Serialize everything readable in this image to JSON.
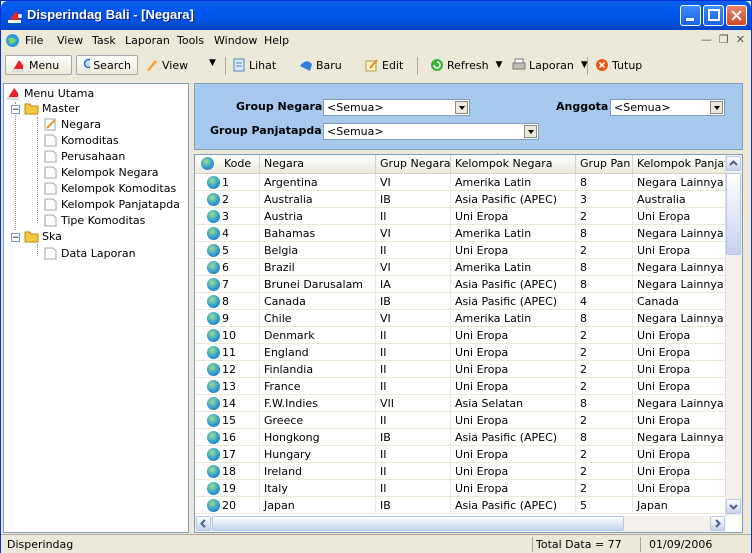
{
  "window": {
    "title": "Disperindag Bali - [Negara]"
  },
  "menu": [
    "File",
    "View",
    "Task",
    "Laporan",
    "Tools",
    "Window",
    "Help"
  ],
  "toolbar": {
    "menu": "Menu",
    "search": "Search",
    "view": "View",
    "lihat": "Lihat",
    "baru": "Baru",
    "edit": "Edit",
    "refresh": "Refresh",
    "laporan": "Laporan",
    "tutup": "Tutup"
  },
  "tree": {
    "root": "Menu Utama",
    "master": "Master",
    "master_items": [
      "Negara",
      "Komoditas",
      "Perusahaan",
      "Kelompok Negara",
      "Kelompok Komoditas",
      "Kelompok Panjatapda",
      "Tipe Komoditas"
    ],
    "ska": "Ska",
    "ska_items": [
      "Data Laporan"
    ]
  },
  "filters": {
    "group_negara_label": "Group Negara",
    "group_negara_value": "<Semua>",
    "anggota_label": "Anggota",
    "anggota_value": "<Semua>",
    "group_panjatapda_label": "Group Panjatapda",
    "group_panjatapda_value": "<Semua>"
  },
  "grid": {
    "columns": [
      "Kode",
      "Negara",
      "Grup Negara",
      "Kelompok Negara",
      "Grup Pan",
      "Kelompok Panjata"
    ],
    "rows": [
      [
        "1",
        "Argentina",
        "VI",
        "Amerika Latin",
        "8",
        "Negara Lainnya"
      ],
      [
        "2",
        "Australia",
        "IB",
        "Asia Pasific (APEC)",
        "3",
        "Australia"
      ],
      [
        "3",
        "Austria",
        "II",
        "Uni Eropa",
        "2",
        "Uni Eropa"
      ],
      [
        "4",
        "Bahamas",
        "VI",
        "Amerika Latin",
        "8",
        "Negara Lainnya"
      ],
      [
        "5",
        "Belgia",
        "II",
        "Uni Eropa",
        "2",
        "Uni Eropa"
      ],
      [
        "6",
        "Brazil",
        "VI",
        "Amerika Latin",
        "8",
        "Negara Lainnya"
      ],
      [
        "7",
        "Brunei Darusalam",
        "IA",
        "Asia Pasific (APEC)",
        "8",
        "Negara Lainnya"
      ],
      [
        "8",
        "Canada",
        "IB",
        "Asia Pasific (APEC)",
        "4",
        "Canada"
      ],
      [
        "9",
        "Chile",
        "VI",
        "Amerika Latin",
        "8",
        "Negara Lainnya"
      ],
      [
        "10",
        "Denmark",
        "II",
        "Uni Eropa",
        "2",
        "Uni Eropa"
      ],
      [
        "11",
        "England",
        "II",
        "Uni Eropa",
        "2",
        "Uni Eropa"
      ],
      [
        "12",
        "Finlandia",
        "II",
        "Uni Eropa",
        "2",
        "Uni Eropa"
      ],
      [
        "13",
        "France",
        "II",
        "Uni Eropa",
        "2",
        "Uni Eropa"
      ],
      [
        "14",
        "F.W.Indies",
        "VII",
        "Asia Selatan",
        "8",
        "Negara Lainnya"
      ],
      [
        "15",
        "Greece",
        "II",
        "Uni Eropa",
        "2",
        "Uni Eropa"
      ],
      [
        "16",
        "Hongkong",
        "IB",
        "Asia Pasific (APEC)",
        "8",
        "Negara Lainnya"
      ],
      [
        "17",
        "Hungary",
        "II",
        "Uni Eropa",
        "2",
        "Uni Eropa"
      ],
      [
        "18",
        "Ireland",
        "II",
        "Uni Eropa",
        "2",
        "Uni Eropa"
      ],
      [
        "19",
        "Italy",
        "II",
        "Uni Eropa",
        "2",
        "Uni Eropa"
      ],
      [
        "20",
        "Japan",
        "IB",
        "Asia Pasific (APEC)",
        "5",
        "Japan"
      ]
    ]
  },
  "status": {
    "app": "Disperindag",
    "total": "Total Data = 77",
    "date": "01/09/2006"
  },
  "colors": {
    "header_bg": "#A8C9EE",
    "titlebar": "#0058EE"
  }
}
